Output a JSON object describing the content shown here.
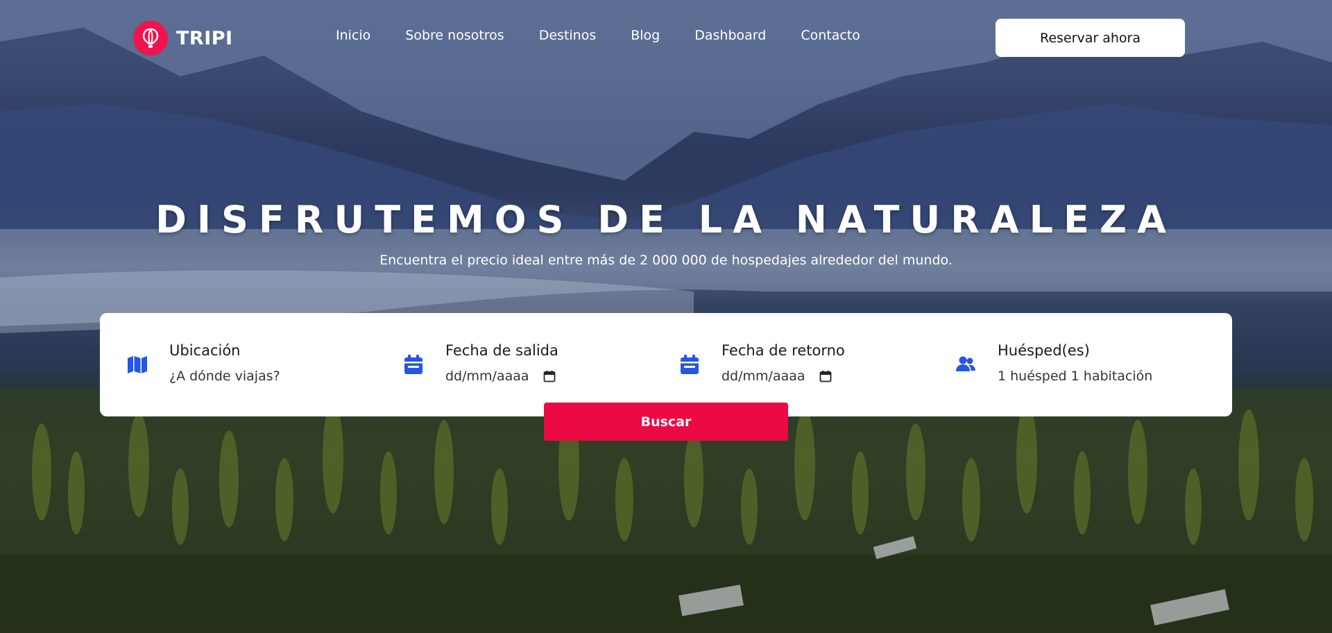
{
  "brand": {
    "name": "TRIPI",
    "accent": "#f0134d"
  },
  "nav": {
    "items": [
      {
        "label": "Inicio"
      },
      {
        "label": "Sobre nosotros"
      },
      {
        "label": "Destinos"
      },
      {
        "label": "Blog"
      },
      {
        "label": "Dashboard"
      },
      {
        "label": "Contacto"
      }
    ],
    "cta_label": "Reservar ahora"
  },
  "hero": {
    "title": "DISFRUTEMOS DE LA NATURALEZA",
    "subtitle": "Encuentra el precio ideal entre más de 2 000 000 de hospedajes alrededor del mundo."
  },
  "search": {
    "location": {
      "label": "Ubicación",
      "placeholder": "¿A dónde viajas?",
      "icon": "map-icon"
    },
    "departure": {
      "label": "Fecha de salida",
      "value": "dd/mm/aaaa",
      "icon": "calendar-icon"
    },
    "return": {
      "label": "Fecha de retorno",
      "value": "dd/mm/aaaa",
      "icon": "calendar-icon"
    },
    "guests": {
      "label": "Huésped(es)",
      "value": "1 huésped 1 habitación",
      "icon": "users-icon"
    },
    "submit_label": "Buscar",
    "icon_color": "#2455e6",
    "submit_color": "#eb0a44"
  }
}
